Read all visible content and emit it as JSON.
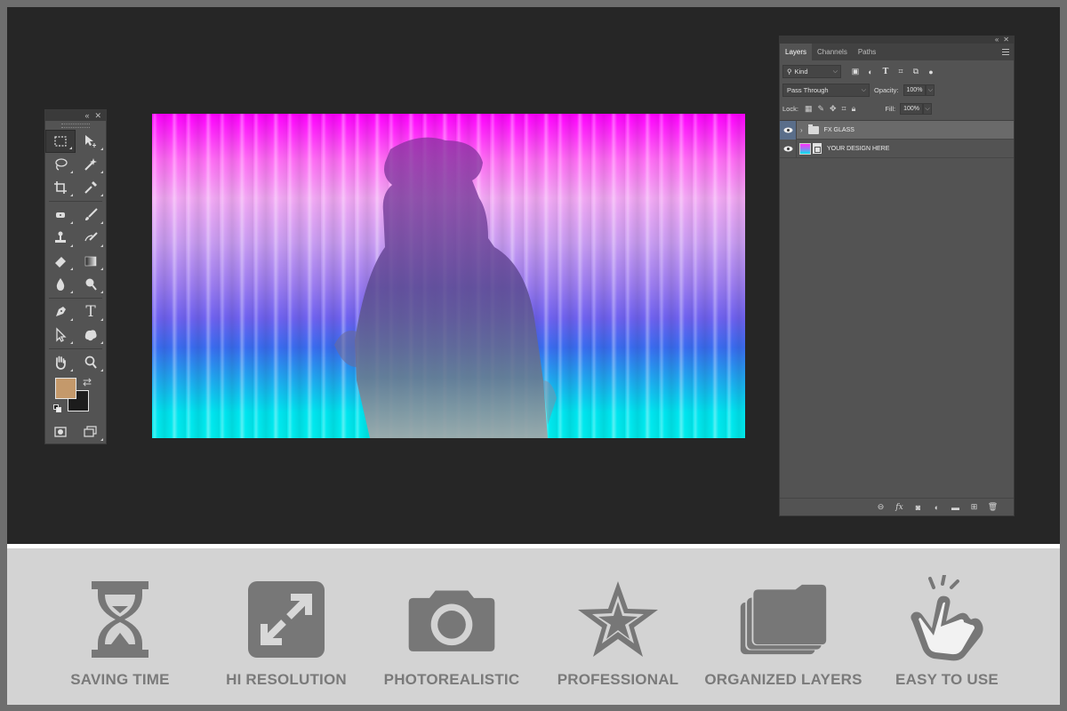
{
  "colors": {
    "frame": "#6e6e6e",
    "workspace": "#262626",
    "panel": "#535353",
    "feature_bar": "#d3d3d3",
    "feature_icon": "#777777",
    "feature_label": "#7a7a7a",
    "foreground_swatch": "#c4996b",
    "background_swatch": "#1c1c1c"
  },
  "toolbar": {
    "tools": [
      [
        "rectangular-marquee-tool",
        "move-tool"
      ],
      [
        "lasso-tool",
        "magic-wand-tool"
      ],
      [
        "crop-tool",
        "eyedropper-tool"
      ],
      [
        "spot-healing-tool",
        "brush-tool"
      ],
      [
        "clone-stamp-tool",
        "history-brush-tool"
      ],
      [
        "eraser-tool",
        "gradient-tool"
      ],
      [
        "blur-tool",
        "dodge-tool"
      ],
      [
        "pen-tool",
        "type-tool"
      ],
      [
        "path-selection-tool",
        "custom-shape-tool"
      ],
      [
        "hand-tool",
        "zoom-tool"
      ]
    ],
    "type_tool_glyph": "T"
  },
  "layers_panel": {
    "tabs": [
      "Layers",
      "Channels",
      "Paths"
    ],
    "filter_kind": "Kind",
    "blend_mode": "Pass Through",
    "opacity_label": "Opacity:",
    "opacity_value": "100%",
    "lock_label": "Lock:",
    "fill_label": "Fill:",
    "fill_value": "100%",
    "layers": [
      {
        "name": "FX GLASS",
        "type": "group",
        "selected": true
      },
      {
        "name": "YOUR DESIGN HERE",
        "type": "smart-object",
        "selected": false
      }
    ],
    "footer_fx": "fx"
  },
  "features": [
    {
      "label": "SAVING TIME",
      "icon": "hourglass-icon"
    },
    {
      "label": "HI RESOLUTION",
      "icon": "expand-arrows-icon"
    },
    {
      "label": "PHOTOREALISTIC",
      "icon": "camera-icon"
    },
    {
      "label": "PROFESSIONAL",
      "icon": "star-icon"
    },
    {
      "label": "ORGANIZED LAYERS",
      "icon": "stacked-folders-icon"
    },
    {
      "label": "EASY TO USE",
      "icon": "tap-hand-icon"
    }
  ]
}
